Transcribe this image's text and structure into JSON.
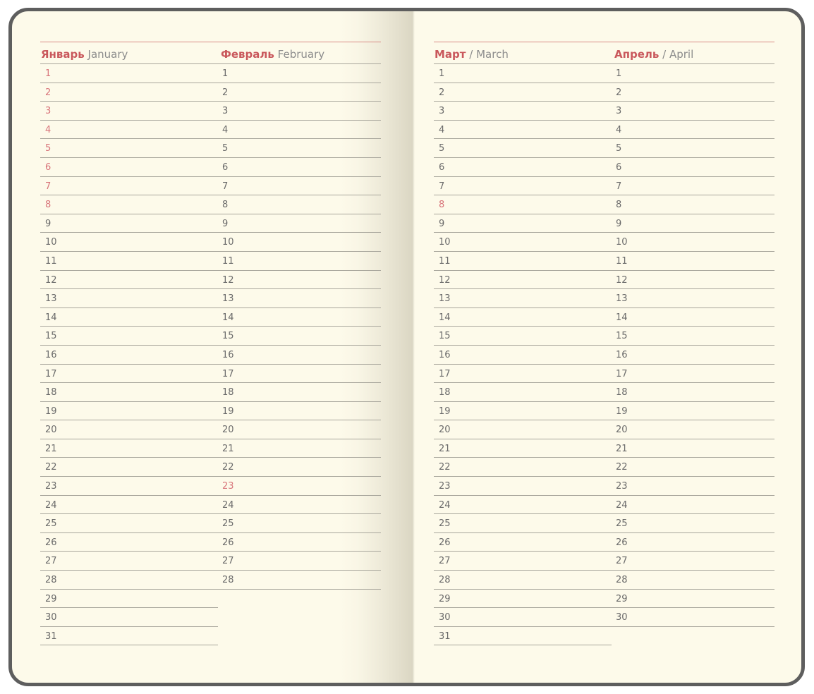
{
  "colors": {
    "cover": "#5e5e5e",
    "paper": "#fdfaea",
    "accent": "#c9585c",
    "highlight_day": "#d8747a",
    "day_text": "#6a6a6a",
    "rule": "#a8a69c"
  },
  "pages": [
    {
      "months": [
        {
          "name_ru": "Январь",
          "separator": "",
          "name_en": "January",
          "days": [
            "1",
            "2",
            "3",
            "4",
            "5",
            "6",
            "7",
            "8",
            "9",
            "10",
            "11",
            "12",
            "13",
            "14",
            "15",
            "16",
            "17",
            "18",
            "19",
            "20",
            "21",
            "22",
            "23",
            "24",
            "25",
            "26",
            "27",
            "28",
            "29",
            "30",
            "31"
          ],
          "highlighted": [
            "1",
            "2",
            "3",
            "4",
            "5",
            "6",
            "7",
            "8"
          ]
        },
        {
          "name_ru": "Февраль",
          "separator": "",
          "name_en": "February",
          "days": [
            "1",
            "2",
            "3",
            "4",
            "5",
            "6",
            "7",
            "8",
            "9",
            "10",
            "11",
            "12",
            "13",
            "14",
            "15",
            "16",
            "17",
            "18",
            "19",
            "20",
            "21",
            "22",
            "23",
            "24",
            "25",
            "26",
            "27",
            "28"
          ],
          "highlighted": [
            "23"
          ]
        }
      ]
    },
    {
      "months": [
        {
          "name_ru": "Март",
          "separator": "/",
          "name_en": "March",
          "days": [
            "1",
            "2",
            "3",
            "4",
            "5",
            "6",
            "7",
            "8",
            "9",
            "10",
            "11",
            "12",
            "13",
            "14",
            "15",
            "16",
            "17",
            "18",
            "19",
            "20",
            "21",
            "22",
            "23",
            "24",
            "25",
            "26",
            "27",
            "28",
            "29",
            "30",
            "31"
          ],
          "highlighted": [
            "8"
          ]
        },
        {
          "name_ru": "Апрель",
          "separator": "/",
          "name_en": "April",
          "days": [
            "1",
            "2",
            "3",
            "4",
            "5",
            "6",
            "7",
            "8",
            "9",
            "10",
            "11",
            "12",
            "13",
            "14",
            "15",
            "16",
            "17",
            "18",
            "19",
            "20",
            "21",
            "22",
            "23",
            "24",
            "25",
            "26",
            "27",
            "28",
            "29",
            "30"
          ],
          "highlighted": []
        }
      ]
    }
  ]
}
